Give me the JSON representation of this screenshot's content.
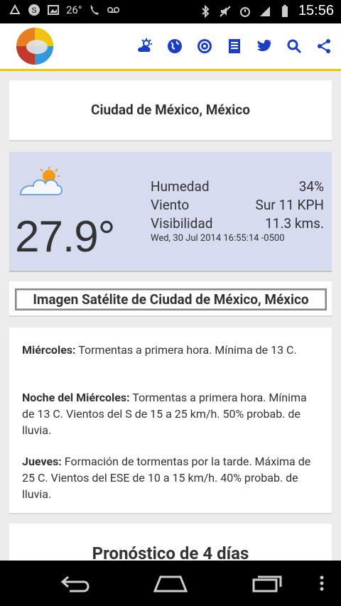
{
  "status_bar": {
    "time": "15:56",
    "temp_small": "26°",
    "signal_label": "H"
  },
  "header": {
    "icons": [
      "weather-icon",
      "globe-icon",
      "radar-icon",
      "news-icon",
      "twitter-icon",
      "search-icon",
      "share-icon"
    ]
  },
  "city": {
    "title": "Ciudad de México, México"
  },
  "current": {
    "temperature": "27.9°",
    "humidity_label": "Humedad",
    "humidity_value": "34%",
    "wind_label": "Viento",
    "wind_value": "Sur 11 KPH",
    "visibility_label": "Visibilidad",
    "visibility_value": "11.3 kms.",
    "timestamp": "Wed, 30 Jul 2014 16:55:14 -0500"
  },
  "satellite": {
    "label": "Imagen Satélite de Ciudad de México, México"
  },
  "forecast": [
    {
      "title": "Miércoles:",
      "text": " Tormentas a primera hora. Mínima de 13 C."
    },
    {
      "title": "Noche del Miércoles:",
      "text": " Tormentas a primera hora. Mínima de 13 C. Vientos del S de 15 a 25 km/h. 50% probab. de lluvia."
    },
    {
      "title": "Jueves:",
      "text": " Formación de tormentas por la tarde. Máxima de 25 C. Vientos del ESE de 10 a 15 km/h. 40% probab. de lluvia."
    }
  ],
  "pronostico": {
    "title": "Pronóstico de 4 días"
  },
  "colors": {
    "accent": "#f1c40f",
    "icon_blue": "#1a3ec7",
    "weather_bg": "#d7dbef"
  }
}
